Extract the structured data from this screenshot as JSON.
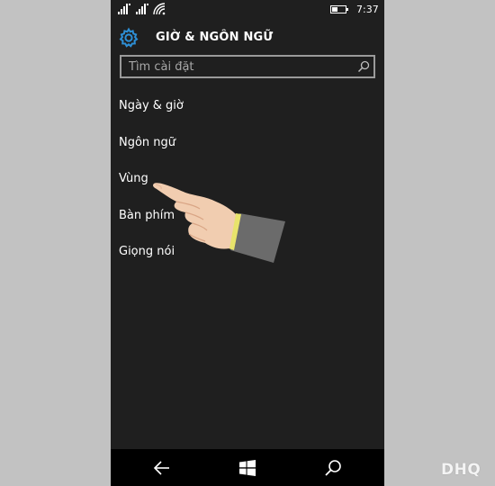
{
  "status_bar": {
    "time": "7:37"
  },
  "header": {
    "title": "GIỜ & NGÔN NGỮ",
    "icon": "gear-icon"
  },
  "search": {
    "placeholder": "Tìm cài đặt",
    "value": ""
  },
  "menu": {
    "items": [
      {
        "label": "Ngày & giờ"
      },
      {
        "label": "Ngôn ngữ"
      },
      {
        "label": "Vùng"
      },
      {
        "label": "Bàn phím"
      },
      {
        "label": "Giọng nói"
      }
    ]
  },
  "colors": {
    "accent": "#2d8fd6",
    "background": "#1f1f1f",
    "nav": "#000000"
  },
  "watermark": "DHQ"
}
